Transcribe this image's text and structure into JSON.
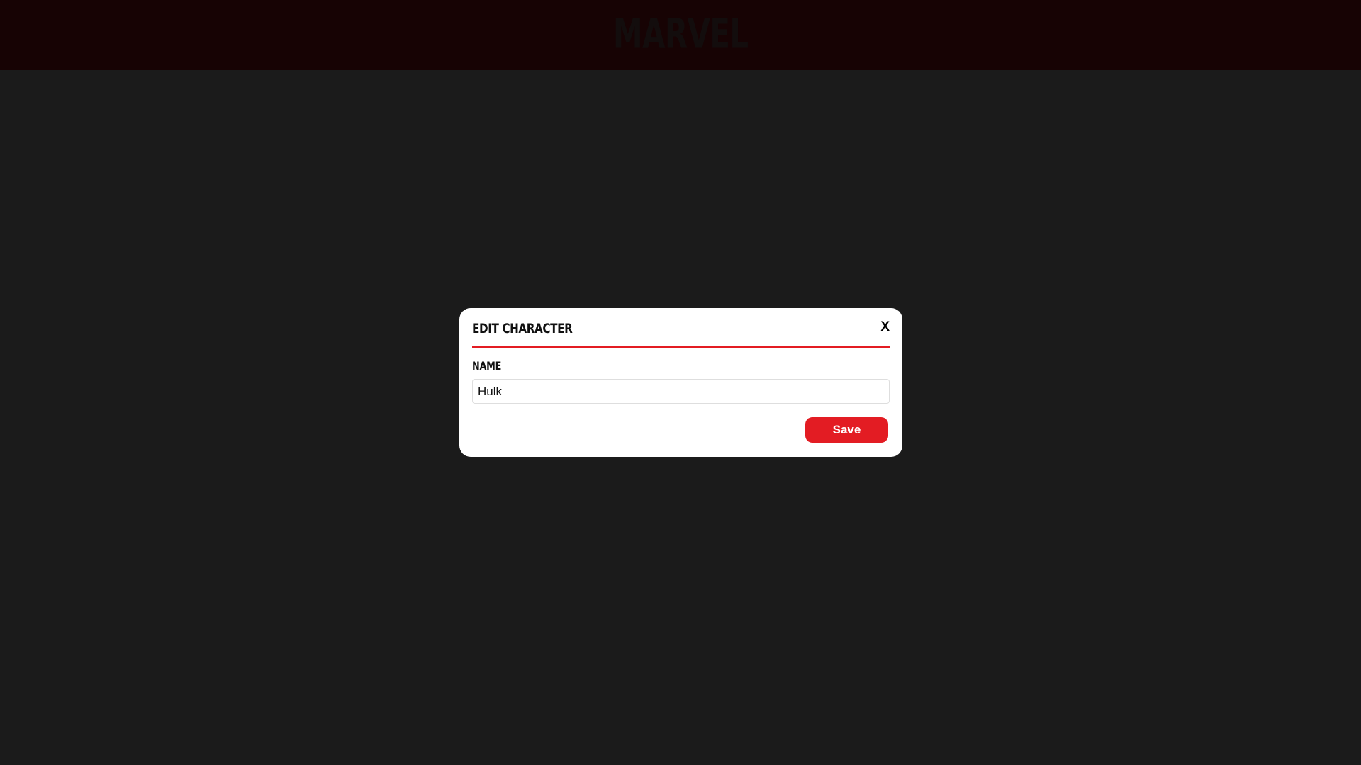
{
  "header": {
    "brand": "MARVEL"
  },
  "modal": {
    "title": "EDIT CHARACTER",
    "close_label": "X",
    "field": {
      "label": "NAME",
      "value": "Hulk",
      "placeholder": ""
    },
    "save_label": "Save"
  },
  "colors": {
    "page_background": "#1b1b1b",
    "header_background": "#170304",
    "accent": "#e31c23",
    "modal_background": "#ffffff"
  }
}
